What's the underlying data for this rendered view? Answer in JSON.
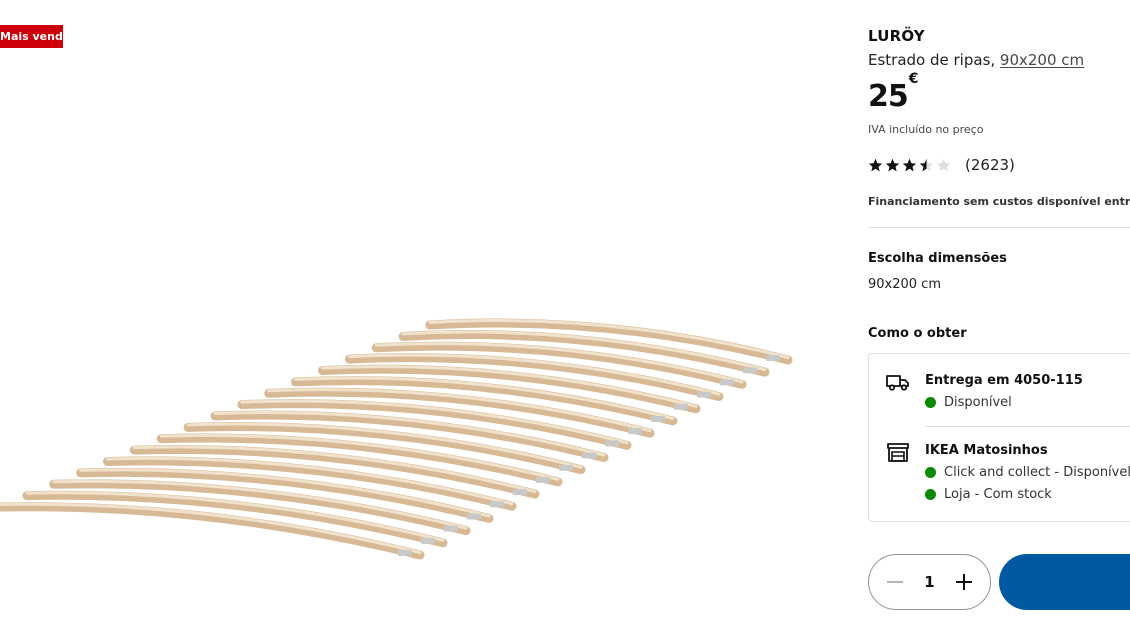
{
  "badge": {
    "label": "Mais vendido"
  },
  "product": {
    "name": "LURÖY",
    "description_prefix": "Estrado de ripas, ",
    "description_size": "90x200 cm",
    "price_value": "25",
    "price_currency": "€",
    "vat_note": "IVA incluído no preço",
    "rating": {
      "value": 3.5,
      "max": 5,
      "count_label": "(2623)"
    },
    "financing_note": "Financiamento sem custos disponível entre"
  },
  "dimensions": {
    "title": "Escolha dimensões",
    "value": "90x200 cm"
  },
  "obtain": {
    "title": "Como o obter",
    "delivery": {
      "title": "Entrega em 4050-115",
      "status": "Disponível",
      "icon": "truck-icon"
    },
    "store": {
      "title": "IKEA Matosinhos",
      "icon": "store-icon",
      "statuses": [
        "Click and collect - Disponível",
        "Loja - Com stock"
      ]
    },
    "status_color": "#0a8a00"
  },
  "quantity": {
    "value": "1"
  },
  "colors": {
    "badge": "#cc0008",
    "primary_button": "#0058a3"
  }
}
